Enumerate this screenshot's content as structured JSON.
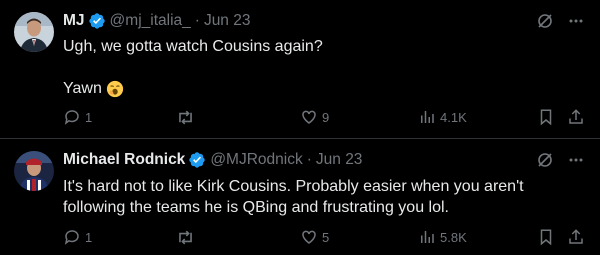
{
  "tweets": [
    {
      "name": "MJ",
      "handle": "@mj_italia_",
      "separator": "·",
      "date": "Jun 23",
      "text_line1": "Ugh, we gotta watch Cousins again?",
      "text_line2": "Yawn",
      "emoji": "yawning-face",
      "replies": "1",
      "retweets": "",
      "likes": "9",
      "views": "4.1K"
    },
    {
      "name": "Michael Rodnick",
      "handle": "@MJRodnick",
      "separator": "·",
      "date": "Jun 23",
      "text": "It's hard not to like Kirk Cousins.  Probably easier when you aren't following the teams he is QBing and frustrating you lol.",
      "replies": "1",
      "retweets": "",
      "likes": "5",
      "views": "5.8K"
    }
  ],
  "colors": {
    "background": "#000000",
    "text": "#e7e9ea",
    "muted": "#71767b",
    "verified": "#1d9bf0",
    "divider": "#2f3336"
  }
}
